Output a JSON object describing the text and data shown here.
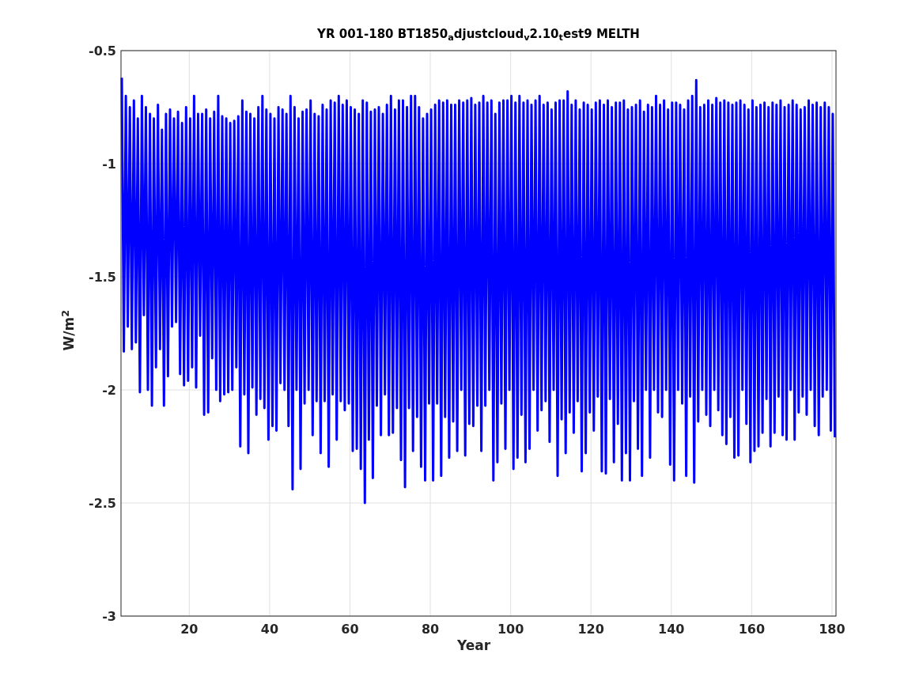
{
  "chart_data": {
    "type": "line",
    "title": "YR 001-180 BT1850$_{a}$djustcloud$_{v}$2.10$_{t}$est9 MELTH",
    "xlabel": "Year",
    "ylabel": "W/m$^{2}$",
    "x": [
      3.2,
      3.7,
      4.2,
      4.7,
      5.2,
      5.7,
      6.2,
      6.7,
      7.2,
      7.7,
      8.2,
      8.7,
      9.2,
      9.7,
      10.2,
      10.7,
      11.2,
      11.7,
      12.2,
      12.7,
      13.2,
      13.7,
      14.2,
      14.7,
      15.2,
      15.7,
      16.2,
      16.7,
      17.2,
      17.7,
      18.2,
      18.7,
      19.2,
      19.7,
      20.2,
      20.7,
      21.2,
      21.7,
      22.2,
      22.7,
      23.2,
      23.7,
      24.2,
      24.7,
      25.2,
      25.7,
      26.2,
      26.7,
      27.2,
      27.7,
      28.2,
      28.7,
      29.2,
      29.7,
      30.2,
      30.7,
      31.2,
      31.7,
      32.2,
      32.7,
      33.2,
      33.7,
      34.2,
      34.7,
      35.2,
      35.7,
      36.2,
      36.7,
      37.2,
      37.7,
      38.2,
      38.7,
      39.2,
      39.7,
      40.2,
      40.7,
      41.2,
      41.7,
      42.2,
      42.7,
      43.2,
      43.7,
      44.2,
      44.7,
      45.2,
      45.7,
      46.2,
      46.7,
      47.2,
      47.7,
      48.2,
      48.7,
      49.2,
      49.7,
      50.2,
      50.7,
      51.2,
      51.7,
      52.2,
      52.7,
      53.2,
      53.7,
      54.2,
      54.7,
      55.2,
      55.7,
      56.2,
      56.7,
      57.2,
      57.7,
      58.2,
      58.7,
      59.2,
      59.7,
      60.2,
      60.7,
      61.2,
      61.7,
      62.2,
      62.7,
      63.2,
      63.7,
      64.2,
      64.7,
      65.2,
      65.7,
      66.2,
      66.7,
      67.2,
      67.7,
      68.2,
      68.7,
      69.2,
      69.7,
      70.2,
      70.7,
      71.2,
      71.7,
      72.2,
      72.7,
      73.2,
      73.7,
      74.2,
      74.7,
      75.2,
      75.7,
      76.2,
      76.7,
      77.2,
      77.7,
      78.2,
      78.7,
      79.2,
      79.7,
      80.2,
      80.7,
      81.2,
      81.7,
      82.2,
      82.7,
      83.2,
      83.7,
      84.2,
      84.7,
      85.2,
      85.7,
      86.2,
      86.7,
      87.2,
      87.7,
      88.2,
      88.7,
      89.2,
      89.7,
      90.2,
      90.7,
      91.2,
      91.7,
      92.2,
      92.7,
      93.2,
      93.7,
      94.2,
      94.7,
      95.2,
      95.7,
      96.2,
      96.7,
      97.2,
      97.7,
      98.2,
      98.7,
      99.2,
      99.7,
      100.2,
      100.7,
      101.2,
      101.7,
      102.2,
      102.7,
      103.2,
      103.7,
      104.2,
      104.7,
      105.2,
      105.7,
      106.2,
      106.7,
      107.2,
      107.7,
      108.2,
      108.7,
      109.2,
      109.7,
      110.2,
      110.7,
      111.2,
      111.7,
      112.2,
      112.7,
      113.2,
      113.7,
      114.2,
      114.7,
      115.2,
      115.7,
      116.2,
      116.7,
      117.2,
      117.7,
      118.2,
      118.7,
      119.2,
      119.7,
      120.2,
      120.7,
      121.2,
      121.7,
      122.2,
      122.7,
      123.2,
      123.7,
      124.2,
      124.7,
      125.2,
      125.7,
      126.2,
      126.7,
      127.2,
      127.7,
      128.2,
      128.7,
      129.2,
      129.7,
      130.2,
      130.7,
      131.2,
      131.7,
      132.2,
      132.7,
      133.2,
      133.7,
      134.2,
      134.7,
      135.2,
      135.7,
      136.2,
      136.7,
      137.2,
      137.7,
      138.2,
      138.7,
      139.2,
      139.7,
      140.2,
      140.7,
      141.2,
      141.7,
      142.2,
      142.7,
      143.2,
      143.7,
      144.2,
      144.7,
      145.2,
      145.7,
      146.2,
      146.7,
      147.2,
      147.7,
      148.2,
      148.7,
      149.2,
      149.7,
      150.2,
      150.7,
      151.2,
      151.7,
      152.2,
      152.7,
      153.2,
      153.7,
      154.2,
      154.7,
      155.2,
      155.7,
      156.2,
      156.7,
      157.2,
      157.7,
      158.2,
      158.7,
      159.2,
      159.7,
      160.2,
      160.7,
      161.2,
      161.7,
      162.2,
      162.7,
      163.2,
      163.7,
      164.2,
      164.7,
      165.2,
      165.7,
      166.2,
      166.7,
      167.2,
      167.7,
      168.2,
      168.7,
      169.2,
      169.7,
      170.2,
      170.7,
      171.2,
      171.7,
      172.2,
      172.7,
      173.2,
      173.7,
      174.2,
      174.7,
      175.2,
      175.7,
      176.2,
      176.7,
      177.2,
      177.7,
      178.2,
      178.7,
      179.2,
      179.7,
      180.2,
      180.7
    ],
    "series": [
      {
        "color": "#0000ff",
        "values": [
          -0.62,
          -1.83,
          -0.7,
          -1.72,
          -0.75,
          -1.82,
          -0.72,
          -1.79,
          -0.8,
          -2.01,
          -0.7,
          -1.67,
          -0.75,
          -2.0,
          -0.78,
          -2.07,
          -0.8,
          -1.9,
          -0.74,
          -1.82,
          -0.85,
          -2.07,
          -0.78,
          -1.94,
          -0.76,
          -1.72,
          -0.8,
          -1.7,
          -0.77,
          -1.93,
          -0.82,
          -1.98,
          -0.75,
          -1.96,
          -0.8,
          -1.9,
          -0.7,
          -1.99,
          -0.78,
          -1.76,
          -0.78,
          -2.11,
          -0.76,
          -2.1,
          -0.8,
          -1.86,
          -0.77,
          -2.0,
          -0.7,
          -2.05,
          -0.79,
          -2.02,
          -0.8,
          -2.01,
          -0.82,
          -2.0,
          -0.81,
          -1.9,
          -0.79,
          -2.25,
          -0.72,
          -2.02,
          -0.77,
          -2.28,
          -0.78,
          -1.99,
          -0.8,
          -2.11,
          -0.75,
          -2.04,
          -0.7,
          -2.08,
          -0.76,
          -2.22,
          -0.78,
          -2.16,
          -0.8,
          -2.18,
          -0.75,
          -1.97,
          -0.76,
          -2.0,
          -0.78,
          -2.16,
          -0.7,
          -2.44,
          -0.75,
          -2.0,
          -0.8,
          -2.35,
          -0.77,
          -2.06,
          -0.76,
          -2.0,
          -0.72,
          -2.2,
          -0.78,
          -2.05,
          -0.79,
          -2.28,
          -0.74,
          -2.05,
          -0.76,
          -2.34,
          -0.72,
          -2.02,
          -0.73,
          -2.22,
          -0.7,
          -2.05,
          -0.74,
          -2.09,
          -0.72,
          -2.06,
          -0.75,
          -2.27,
          -0.76,
          -2.26,
          -0.78,
          -2.35,
          -0.72,
          -2.5,
          -0.73,
          -2.22,
          -0.77,
          -2.39,
          -0.76,
          -2.07,
          -0.75,
          -2.2,
          -0.78,
          -2.02,
          -0.74,
          -2.2,
          -0.7,
          -2.19,
          -0.76,
          -2.08,
          -0.72,
          -2.31,
          -0.72,
          -2.43,
          -0.75,
          -2.08,
          -0.7,
          -2.27,
          -0.7,
          -2.12,
          -0.75,
          -2.34,
          -0.8,
          -2.4,
          -0.78,
          -2.06,
          -0.76,
          -2.4,
          -0.74,
          -2.06,
          -0.72,
          -2.38,
          -0.73,
          -2.12,
          -0.72,
          -2.3,
          -0.74,
          -2.14,
          -0.74,
          -2.27,
          -0.72,
          -2.0,
          -0.73,
          -2.29,
          -0.72,
          -2.15,
          -0.71,
          -2.16,
          -0.74,
          -2.07,
          -0.73,
          -2.27,
          -0.7,
          -2.07,
          -0.73,
          -2.0,
          -0.72,
          -2.4,
          -0.78,
          -2.32,
          -0.73,
          -2.06,
          -0.72,
          -2.26,
          -0.72,
          -2.0,
          -0.7,
          -2.35,
          -0.73,
          -2.3,
          -0.7,
          -2.11,
          -0.73,
          -2.32,
          -0.72,
          -2.26,
          -0.74,
          -2.0,
          -0.72,
          -2.18,
          -0.7,
          -2.09,
          -0.74,
          -2.05,
          -0.73,
          -2.23,
          -0.76,
          -2.0,
          -0.73,
          -2.38,
          -0.72,
          -2.13,
          -0.72,
          -2.28,
          -0.68,
          -2.1,
          -0.74,
          -2.19,
          -0.72,
          -2.05,
          -0.76,
          -2.36,
          -0.73,
          -2.28,
          -0.74,
          -2.1,
          -0.76,
          -2.18,
          -0.73,
          -2.03,
          -0.72,
          -2.36,
          -0.74,
          -2.37,
          -0.72,
          -2.04,
          -0.75,
          -2.32,
          -0.73,
          -2.15,
          -0.73,
          -2.4,
          -0.72,
          -2.28,
          -0.76,
          -2.4,
          -0.75,
          -2.05,
          -0.74,
          -2.26,
          -0.72,
          -2.38,
          -0.77,
          -2.0,
          -0.74,
          -2.3,
          -0.75,
          -2.0,
          -0.7,
          -2.1,
          -0.74,
          -2.12,
          -0.72,
          -2.0,
          -0.76,
          -2.33,
          -0.73,
          -2.4,
          -0.73,
          -2.0,
          -0.74,
          -2.06,
          -0.76,
          -2.38,
          -0.72,
          -2.03,
          -0.7,
          -2.41,
          -0.63,
          -2.14,
          -0.75,
          -2.0,
          -0.74,
          -2.11,
          -0.72,
          -2.16,
          -0.74,
          -2.0,
          -0.71,
          -2.09,
          -0.73,
          -2.2,
          -0.72,
          -2.24,
          -0.73,
          -2.12,
          -0.74,
          -2.3,
          -0.73,
          -2.29,
          -0.72,
          -2.0,
          -0.74,
          -2.15,
          -0.76,
          -2.32,
          -0.72,
          -2.27,
          -0.75,
          -2.25,
          -0.74,
          -2.19,
          -0.73,
          -2.04,
          -0.75,
          -2.25,
          -0.73,
          -2.19,
          -0.74,
          -2.03,
          -0.72,
          -2.2,
          -0.75,
          -2.22,
          -0.74,
          -2.0,
          -0.72,
          -2.22,
          -0.74,
          -2.1,
          -0.76,
          -2.03,
          -0.75,
          -2.11,
          -0.72,
          -2.0,
          -0.74,
          -2.16,
          -0.73,
          -2.2,
          -0.75,
          -2.03,
          -0.73,
          -2.0,
          -0.75,
          -2.18,
          -0.78,
          -2.21
        ]
      }
    ],
    "xlim": [
      3,
      181
    ],
    "ylim": [
      -3,
      -0.5
    ],
    "xticks": [
      {
        "value": 20,
        "label": "20"
      },
      {
        "value": 40,
        "label": "40"
      },
      {
        "value": 60,
        "label": "60"
      },
      {
        "value": 80,
        "label": "80"
      },
      {
        "value": 100,
        "label": "100"
      },
      {
        "value": 120,
        "label": "120"
      },
      {
        "value": 140,
        "label": "140"
      },
      {
        "value": 160,
        "label": "160"
      },
      {
        "value": 180,
        "label": "180"
      }
    ],
    "yticks": [
      -3,
      -2.5,
      -2,
      -1.5,
      -1,
      -0.5
    ],
    "grid": true
  }
}
